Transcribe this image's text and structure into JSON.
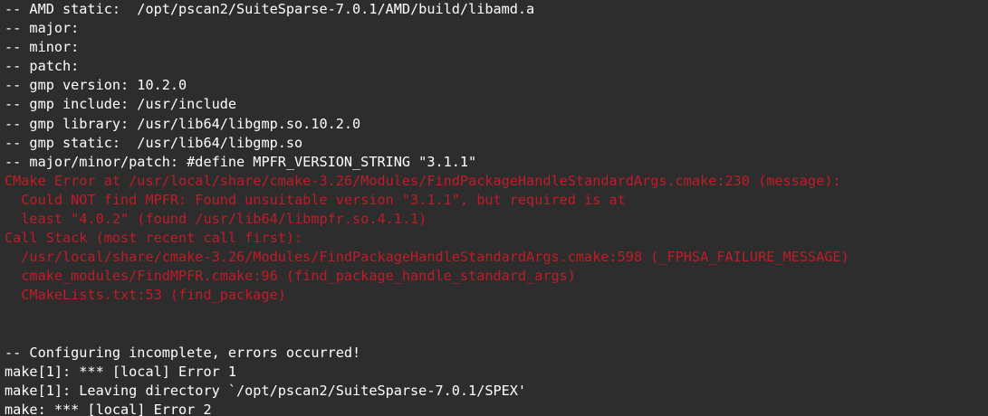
{
  "colors": {
    "background": "#2d2d2d",
    "text": "#ffffff",
    "error": "#c01c28"
  },
  "terminal": {
    "lines": [
      {
        "text": "-- AMD static:  /opt/pscan2/SuiteSparse-7.0.1/AMD/build/libamd.a",
        "style": "normal"
      },
      {
        "text": "-- major:",
        "style": "normal"
      },
      {
        "text": "-- minor:",
        "style": "normal"
      },
      {
        "text": "-- patch:",
        "style": "normal"
      },
      {
        "text": "-- gmp version: 10.2.0",
        "style": "normal"
      },
      {
        "text": "-- gmp include: /usr/include",
        "style": "normal"
      },
      {
        "text": "-- gmp library: /usr/lib64/libgmp.so.10.2.0",
        "style": "normal"
      },
      {
        "text": "-- gmp static:  /usr/lib64/libgmp.so",
        "style": "normal"
      },
      {
        "text": "-- major/minor/patch: #define MPFR_VERSION_STRING \"3.1.1\"",
        "style": "normal"
      },
      {
        "text": "CMake Error at /usr/local/share/cmake-3.26/Modules/FindPackageHandleStandardArgs.cmake:230 (message):",
        "style": "error"
      },
      {
        "text": "  Could NOT find MPFR: Found unsuitable version \"3.1.1\", but required is at",
        "style": "error"
      },
      {
        "text": "  least \"4.0.2\" (found /usr/lib64/libmpfr.so.4.1.1)",
        "style": "error"
      },
      {
        "text": "Call Stack (most recent call first):",
        "style": "error"
      },
      {
        "text": "  /usr/local/share/cmake-3.26/Modules/FindPackageHandleStandardArgs.cmake:598 (_FPHSA_FAILURE_MESSAGE)",
        "style": "error"
      },
      {
        "text": "  cmake_modules/FindMPFR.cmake:96 (find_package_handle_standard_args)",
        "style": "error"
      },
      {
        "text": "  CMakeLists.txt:53 (find_package)",
        "style": "error"
      },
      {
        "text": "",
        "style": "error"
      },
      {
        "text": "",
        "style": "normal"
      },
      {
        "text": "-- Configuring incomplete, errors occurred!",
        "style": "normal"
      },
      {
        "text": "make[1]: *** [local] Error 1",
        "style": "normal"
      },
      {
        "text": "make[1]: Leaving directory `/opt/pscan2/SuiteSparse-7.0.1/SPEX'",
        "style": "normal"
      },
      {
        "text": "make: *** [local] Error 2",
        "style": "normal"
      }
    ]
  }
}
